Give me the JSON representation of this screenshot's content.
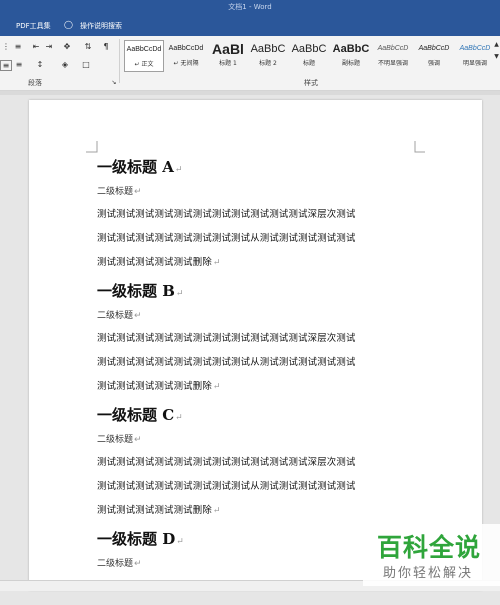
{
  "window": {
    "title": "文档1  -  Word"
  },
  "tabs": [
    {
      "label": "PDF工具集"
    },
    {
      "label": "操作说明搜索"
    }
  ],
  "ribbon": {
    "paragraph_group_label": "段落",
    "styles_group_label": "样式",
    "styles": [
      {
        "preview": "AaBbCcDd",
        "name": "↵ 正文",
        "selected": true
      },
      {
        "preview": "AaBbCcDd",
        "name": "↵ 无间隔"
      },
      {
        "preview": "AaBl",
        "name": "标题 1"
      },
      {
        "preview": "AaBbC",
        "name": "标题 2"
      },
      {
        "preview": "AaBbC",
        "name": "标题"
      },
      {
        "preview": "AaBbC",
        "name": "副标题"
      },
      {
        "preview": "AaBbCcD",
        "name": "不明显强调"
      },
      {
        "preview": "AaBbCcD",
        "name": "强调"
      },
      {
        "preview": "AaBbCcD",
        "name": "明显强调"
      }
    ]
  },
  "document": {
    "paragraph_mark": "↵",
    "sections": [
      {
        "heading1": "一级标题 A",
        "heading2": "二级标题",
        "body": [
          "测试测试测试测试测试测试测试测试测试测试测试深层次测试",
          "测试测试测试测试测试测试测试测试从测试测试测试测试测试",
          "测试测试测试测试测试删除"
        ]
      },
      {
        "heading1": "一级标题 B",
        "heading2": "二级标题",
        "body": [
          "测试测试测试测试测试测试测试测试测试测试测试深层次测试",
          "测试测试测试测试测试测试测试测试从测试测试测试测试测试",
          "测试测试测试测试测试删除"
        ]
      },
      {
        "heading1": "一级标题 C",
        "heading2": "二级标题",
        "body": [
          "测试测试测试测试测试测试测试测试测试测试测试深层次测试",
          "测试测试测试测试测试测试测试测试从测试测试测试测试测试",
          "测试测试测试测试测试删除"
        ]
      },
      {
        "heading1": "一级标题 D",
        "heading2": "二级标题",
        "body": []
      }
    ]
  },
  "watermark": {
    "main": "百科全说",
    "sub": "助你轻松解决"
  },
  "colors": {
    "titlebar": "#2b579a",
    "watermark_green": "#2fa53b"
  }
}
